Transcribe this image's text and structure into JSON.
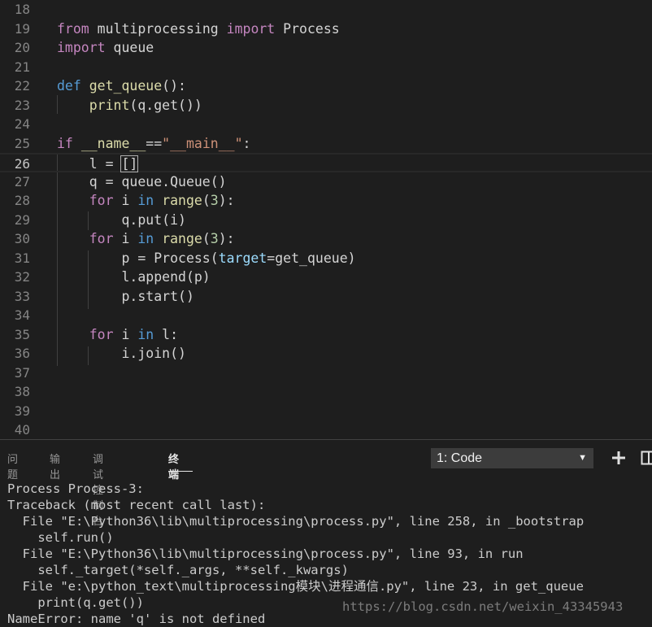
{
  "editor": {
    "lines": [
      {
        "n": "18",
        "tokens": []
      },
      {
        "n": "19",
        "tokens": [
          {
            "t": "from",
            "c": "ctl"
          },
          {
            "t": " multiprocessing ",
            "c": ""
          },
          {
            "t": "import",
            "c": "ctl"
          },
          {
            "t": " Process",
            "c": ""
          }
        ]
      },
      {
        "n": "20",
        "tokens": [
          {
            "t": "import",
            "c": "ctl"
          },
          {
            "t": " queue",
            "c": ""
          }
        ]
      },
      {
        "n": "21",
        "tokens": []
      },
      {
        "n": "22",
        "tokens": [
          {
            "t": "def",
            "c": "kw"
          },
          {
            "t": " ",
            "c": ""
          },
          {
            "t": "get_queue",
            "c": "fn"
          },
          {
            "t": "():",
            "c": ""
          }
        ]
      },
      {
        "n": "23",
        "tokens": [
          {
            "t": "    ",
            "c": ""
          },
          {
            "t": "print",
            "c": "fn"
          },
          {
            "t": "(q.get())",
            "c": ""
          }
        ]
      },
      {
        "n": "24",
        "tokens": []
      },
      {
        "n": "25",
        "tokens": [
          {
            "t": "if",
            "c": "ctl"
          },
          {
            "t": " ",
            "c": ""
          },
          {
            "t": "__name__",
            "c": "fn"
          },
          {
            "t": "==",
            "c": ""
          },
          {
            "t": "\"__main__\"",
            "c": "str"
          },
          {
            "t": ":",
            "c": ""
          }
        ]
      },
      {
        "n": "26",
        "tokens": [
          {
            "t": "    l = ",
            "c": ""
          },
          {
            "t": "[]",
            "c": "cursor"
          }
        ]
      },
      {
        "n": "27",
        "tokens": [
          {
            "t": "    q = queue.Queue()",
            "c": ""
          }
        ]
      },
      {
        "n": "28",
        "tokens": [
          {
            "t": "    ",
            "c": ""
          },
          {
            "t": "for",
            "c": "ctl"
          },
          {
            "t": " i ",
            "c": ""
          },
          {
            "t": "in",
            "c": "kw"
          },
          {
            "t": " ",
            "c": ""
          },
          {
            "t": "range",
            "c": "fn"
          },
          {
            "t": "(",
            "c": ""
          },
          {
            "t": "3",
            "c": "num"
          },
          {
            "t": "):",
            "c": ""
          }
        ]
      },
      {
        "n": "29",
        "tokens": [
          {
            "t": "        q.put(i)",
            "c": ""
          }
        ]
      },
      {
        "n": "30",
        "tokens": [
          {
            "t": "    ",
            "c": ""
          },
          {
            "t": "for",
            "c": "ctl"
          },
          {
            "t": " i ",
            "c": ""
          },
          {
            "t": "in",
            "c": "kw"
          },
          {
            "t": " ",
            "c": ""
          },
          {
            "t": "range",
            "c": "fn"
          },
          {
            "t": "(",
            "c": ""
          },
          {
            "t": "3",
            "c": "num"
          },
          {
            "t": "):",
            "c": ""
          }
        ]
      },
      {
        "n": "31",
        "tokens": [
          {
            "t": "        p = Process(",
            "c": ""
          },
          {
            "t": "target",
            "c": "prm"
          },
          {
            "t": "=get_queue)",
            "c": ""
          }
        ]
      },
      {
        "n": "32",
        "tokens": [
          {
            "t": "        l.append(p)",
            "c": ""
          }
        ]
      },
      {
        "n": "33",
        "tokens": [
          {
            "t": "        p.start()",
            "c": ""
          }
        ]
      },
      {
        "n": "34",
        "tokens": []
      },
      {
        "n": "35",
        "tokens": [
          {
            "t": "    ",
            "c": ""
          },
          {
            "t": "for",
            "c": "ctl"
          },
          {
            "t": " i ",
            "c": ""
          },
          {
            "t": "in",
            "c": "kw"
          },
          {
            "t": " l:",
            "c": ""
          }
        ]
      },
      {
        "n": "36",
        "tokens": [
          {
            "t": "        i.join()",
            "c": ""
          }
        ]
      },
      {
        "n": "37",
        "tokens": []
      },
      {
        "n": "38",
        "tokens": []
      },
      {
        "n": "39",
        "tokens": []
      },
      {
        "n": "40",
        "tokens": []
      }
    ],
    "active_line": "26"
  },
  "panel": {
    "tabs": [
      "问题",
      "输出",
      "调试控制台",
      "终端"
    ],
    "active_tab": "终端",
    "terminal_select": "1: Code",
    "icons": {
      "new_terminal": "plus-icon",
      "split": "split-terminal-icon",
      "dropdown": "chevron-down-icon"
    }
  },
  "terminal": {
    "lines": [
      "Process Process-3:",
      "Traceback (most recent call last):",
      "  File \"E:\\Python36\\lib\\multiprocessing\\process.py\", line 258, in _bootstrap",
      "    self.run()",
      "  File \"E:\\Python36\\lib\\multiprocessing\\process.py\", line 93, in run",
      "    self._target(*self._args, **self._kwargs)",
      "  File \"e:\\python_text\\multiprocessing模块\\进程通信.py\", line 23, in get_queue",
      "    print(q.get())",
      "NameError: name 'q' is not defined"
    ]
  },
  "watermark": "https://blog.csdn.net/weixin_43345943",
  "colors": {
    "background": "#1e1e1e",
    "keyword": "#569cd6",
    "control": "#c586c0",
    "function": "#dcdcaa",
    "string": "#ce9178",
    "number": "#b5cea8",
    "parameter": "#9cdcfe"
  }
}
